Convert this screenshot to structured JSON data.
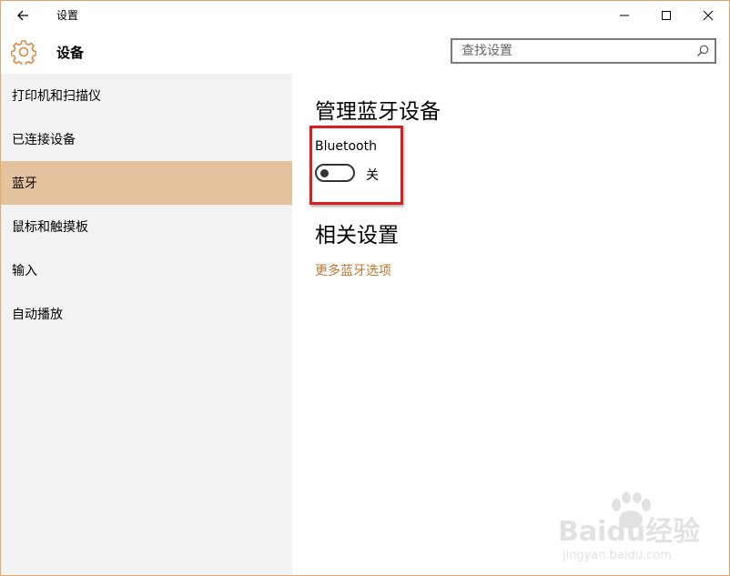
{
  "window": {
    "title": "设置",
    "accent_color": "#e8a46c"
  },
  "header": {
    "app_name": "设备",
    "search": {
      "placeholder": "查找设置"
    }
  },
  "sidebar": {
    "items": [
      {
        "label": "打印机和扫描仪",
        "active": false
      },
      {
        "label": "已连接设备",
        "active": false
      },
      {
        "label": "蓝牙",
        "active": true
      },
      {
        "label": "鼠标和触摸板",
        "active": false
      },
      {
        "label": "输入",
        "active": false
      },
      {
        "label": "自动播放",
        "active": false
      }
    ],
    "active_color": "#e4c29e"
  },
  "main": {
    "title": "管理蓝牙设备",
    "bluetooth": {
      "label": "Bluetooth",
      "state": "关",
      "on": false
    },
    "related_title": "相关设置",
    "more_link": "更多蓝牙选项",
    "link_color": "#c2772b",
    "highlight_color": "#d61f1f"
  },
  "watermark": {
    "main": "Baidu经验",
    "sub": "jingyan.baidu.com"
  }
}
